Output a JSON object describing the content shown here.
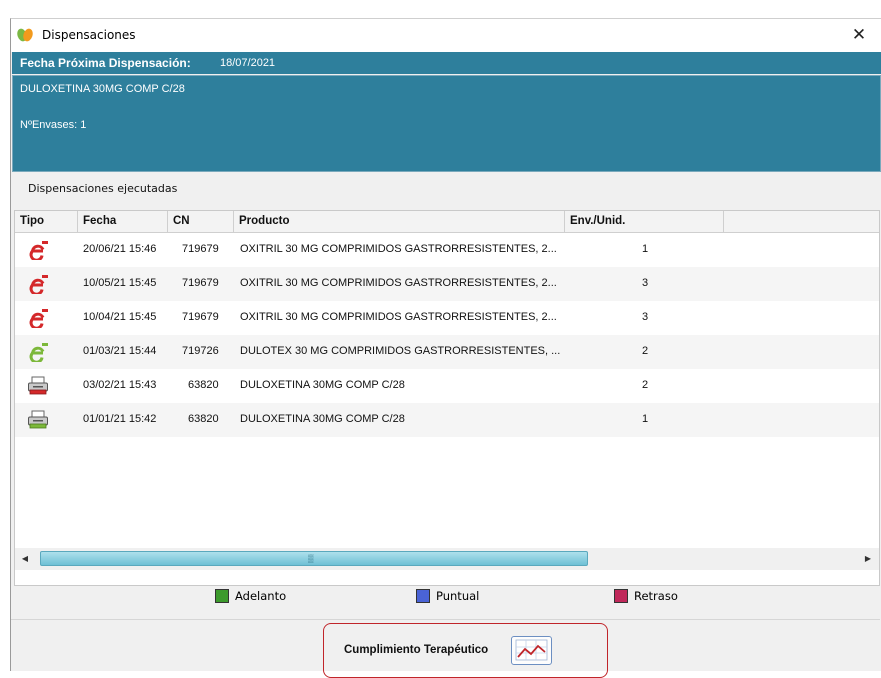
{
  "window": {
    "title": "Dispensaciones",
    "close_icon": "close-icon"
  },
  "next_dispensation": {
    "label": "Fecha Próxima Dispensación:",
    "value": "18/07/2021"
  },
  "product": {
    "name": "DULOXETINA 30MG COMP C/28",
    "envases": "NºEnvases: 1"
  },
  "section": {
    "title": "Dispensaciones ejecutadas"
  },
  "table": {
    "columns": [
      "Tipo",
      "Fecha",
      "CN",
      "Producto",
      "Env./Unid."
    ],
    "rows": [
      {
        "tipo_icon": "e-prescription-red-icon",
        "fecha": "20/06/21 15:46",
        "cn": "719679",
        "producto": "OXITRIL 30 MG COMPRIMIDOS GASTRORRESISTENTES, 2...",
        "env": "1"
      },
      {
        "tipo_icon": "e-prescription-red-icon",
        "fecha": "10/05/21 15:45",
        "cn": "719679",
        "producto": "OXITRIL 30 MG COMPRIMIDOS GASTRORRESISTENTES, 2...",
        "env": "3"
      },
      {
        "tipo_icon": "e-prescription-red-icon",
        "fecha": "10/04/21 15:45",
        "cn": "719679",
        "producto": "OXITRIL 30 MG COMPRIMIDOS GASTRORRESISTENTES, 2...",
        "env": "3"
      },
      {
        "tipo_icon": "e-prescription-green-icon",
        "fecha": "01/03/21 15:44",
        "cn": "719726",
        "producto": "DULOTEX 30 MG COMPRIMIDOS GASTRORRESISTENTES, ...",
        "env": "2"
      },
      {
        "tipo_icon": "printer-red-icon",
        "fecha": "03/02/21 15:43",
        "cn": "63820",
        "producto": "DULOXETINA 30MG COMP C/28",
        "env": "2"
      },
      {
        "tipo_icon": "printer-green-icon",
        "fecha": "01/01/21 15:42",
        "cn": "63820",
        "producto": "DULOXETINA 30MG COMP C/28",
        "env": "1"
      }
    ]
  },
  "legend": [
    {
      "label": "Adelanto",
      "color": "#3c9a2c"
    },
    {
      "label": "Puntual",
      "color": "#4a63d6"
    },
    {
      "label": "Retraso",
      "color": "#c0285a"
    }
  ],
  "compliance": {
    "label": "Cumplimiento Terapéutico",
    "icon": "line-chart-icon"
  }
}
